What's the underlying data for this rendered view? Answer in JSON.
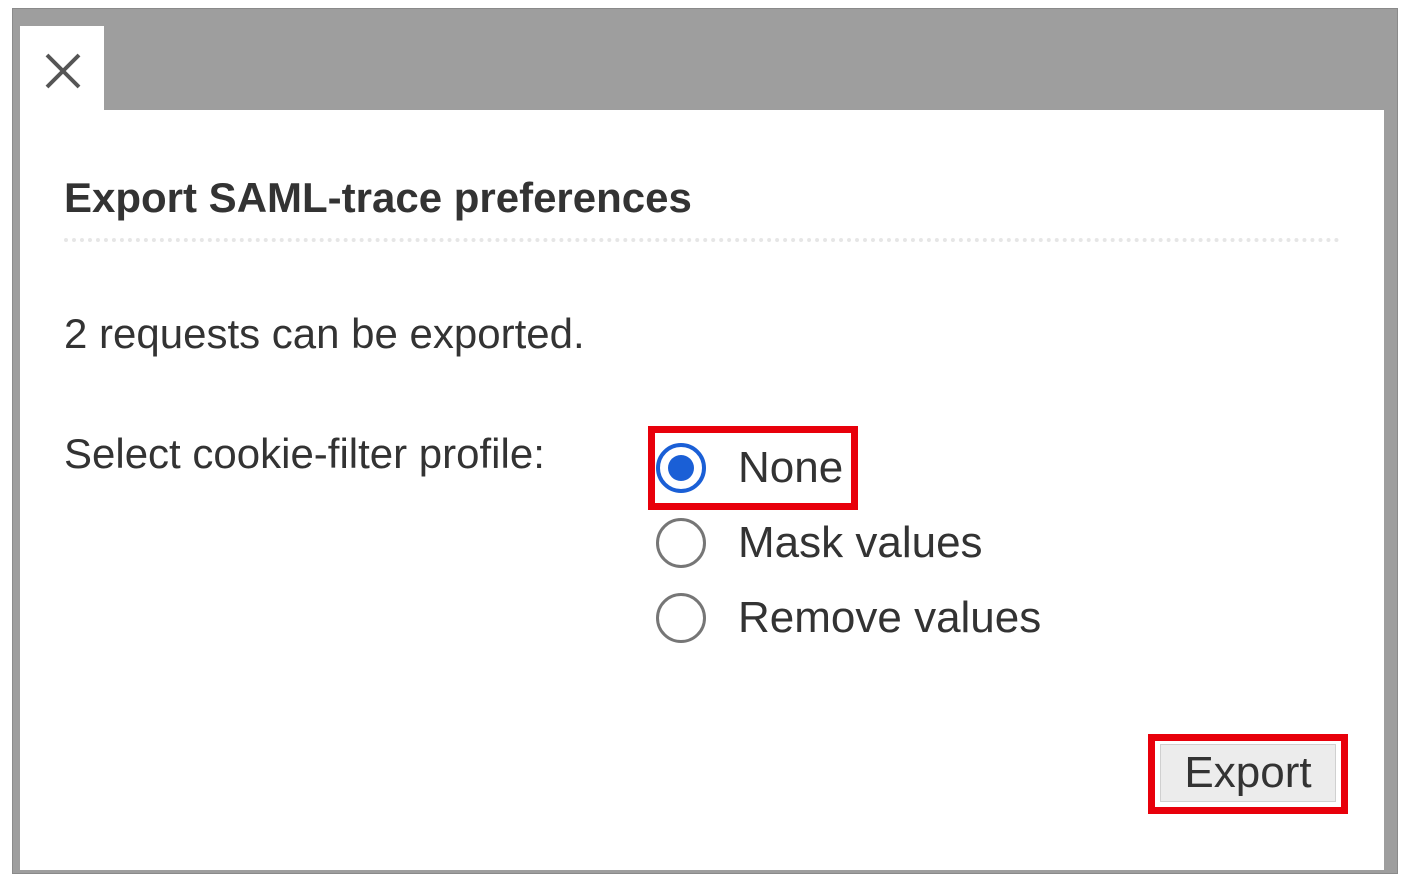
{
  "dialog": {
    "title": "Export SAML-trace preferences",
    "close_icon": "close-icon",
    "request_count_text": "2 requests can be exported.",
    "cookie_filter_label": "Select cookie-filter profile:",
    "profiles": [
      {
        "label": "None",
        "selected": true
      },
      {
        "label": "Mask values",
        "selected": false
      },
      {
        "label": "Remove values",
        "selected": false
      }
    ],
    "export_label": "Export"
  },
  "colors": {
    "frame_gray": "#9e9e9e",
    "radio_selected": "#1a5fd6",
    "highlight_red": "#e8000b"
  }
}
